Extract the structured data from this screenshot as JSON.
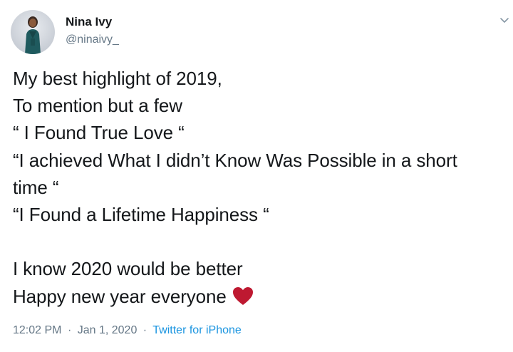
{
  "author": {
    "name": "Nina Ivy",
    "handle": "@ninaivy_"
  },
  "tweet": {
    "lines": [
      "My best highlight of 2019,",
      "To mention but a few",
      "“ I Found True Love “",
      "“I achieved What I didn’t Know Was Possible in a short",
      "time “",
      "“I Found a Lifetime Happiness “",
      "",
      "I know 2020 would be better",
      "Happy new year everyone"
    ],
    "emoji": "red-heart-icon",
    "time": "12:02 PM",
    "date": "Jan 1, 2020",
    "separator": "·",
    "source": "Twitter for iPhone"
  },
  "colors": {
    "text": "#14171a",
    "secondary": "#657786",
    "link": "#1b95e0",
    "heart": "#be1931"
  },
  "icons": {
    "menu": "chevron-down-icon",
    "avatar": "avatar"
  }
}
